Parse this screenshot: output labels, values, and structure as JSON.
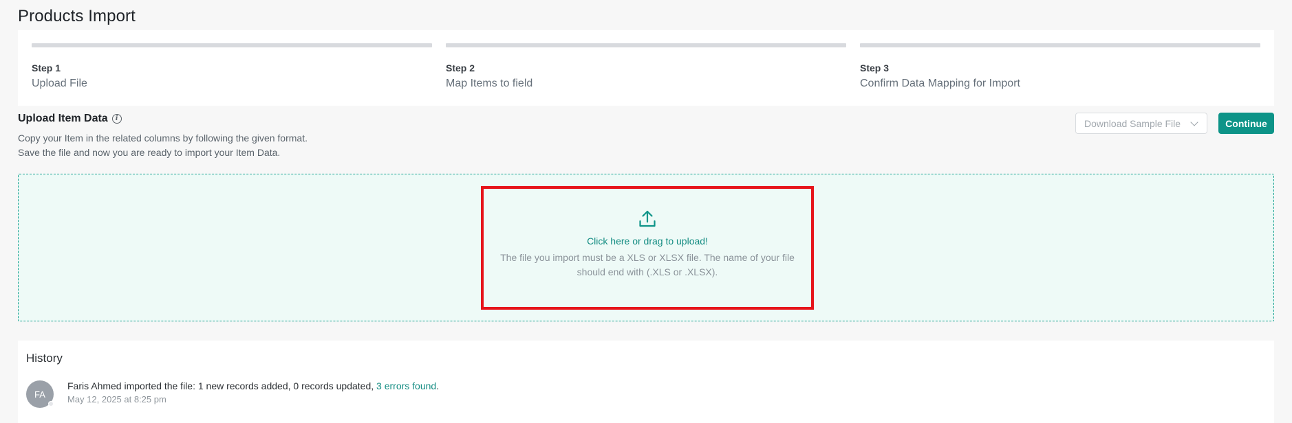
{
  "page": {
    "title": "Products Import"
  },
  "steps": [
    {
      "label": "Step 1",
      "title": "Upload File"
    },
    {
      "label": "Step 2",
      "title": "Map Items to field"
    },
    {
      "label": "Step 3",
      "title": "Confirm Data Mapping for Import"
    }
  ],
  "upload": {
    "title": "Upload Item Data",
    "info_icon": "info-icon",
    "desc_line1": "Copy your Item in the related columns by following the given format.",
    "desc_line2": "Save the file and now you are ready to import your Item Data.",
    "download_label": "Download Sample File",
    "continue_label": "Continue",
    "accent_color": "#0d9488"
  },
  "dropzone": {
    "icon": "upload-icon",
    "cta": "Click here or drag to upload!",
    "help": "The file you import must be a XLS or XLSX file. The name of your file should end with (.XLS or .XLSX)."
  },
  "history": {
    "title": "History",
    "items": [
      {
        "initials": "FA",
        "text_prefix": "Faris Ahmed imported the file: 1 new records added, 0 records updated, ",
        "link_text": "3 errors found",
        "text_suffix": ".",
        "time": "May 12, 2025 at 8:25 pm"
      }
    ]
  }
}
